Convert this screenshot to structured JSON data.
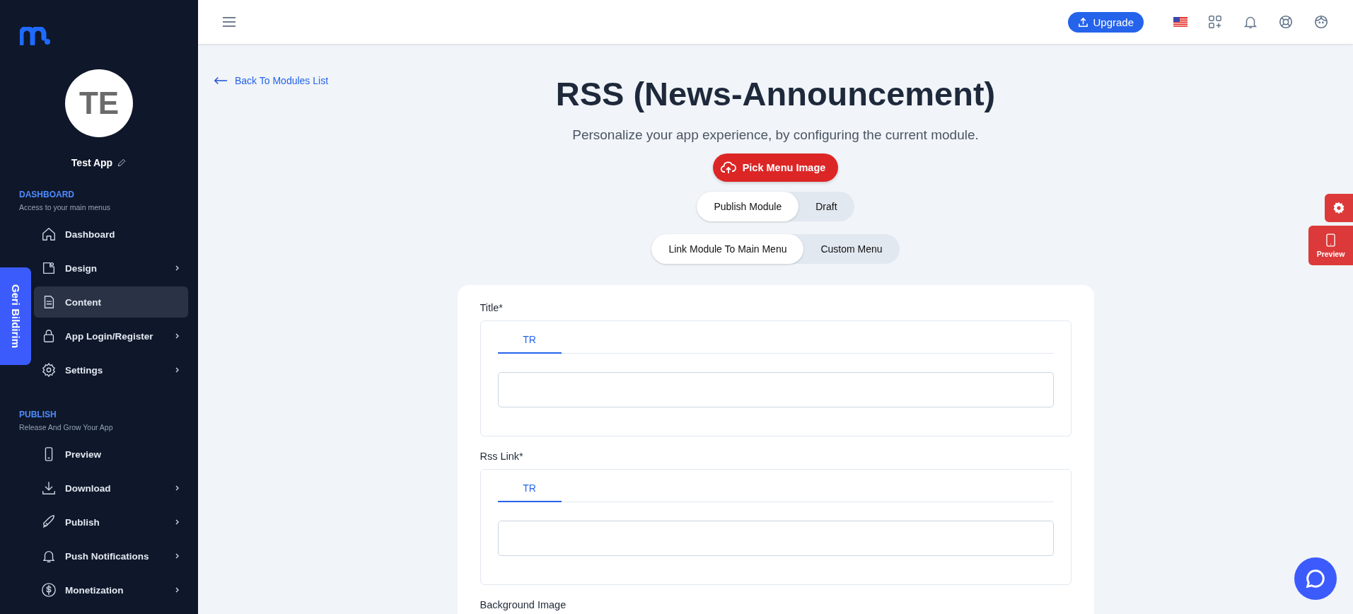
{
  "sidebar": {
    "app_avatar": "TE",
    "app_name": "Test App",
    "sections": [
      {
        "title": "DASHBOARD",
        "subtitle": "Access to your main menus",
        "items": [
          {
            "label": "Dashboard",
            "expandable": false,
            "selected": false
          },
          {
            "label": "Design",
            "expandable": true,
            "selected": false
          },
          {
            "label": "Content",
            "expandable": false,
            "selected": true
          },
          {
            "label": "App Login/Register",
            "expandable": true,
            "selected": false
          },
          {
            "label": "Settings",
            "expandable": true,
            "selected": false
          }
        ]
      },
      {
        "title": "PUBLISH",
        "subtitle": "Release And Grow Your App",
        "items": [
          {
            "label": "Preview",
            "expandable": false,
            "selected": false
          },
          {
            "label": "Download",
            "expandable": true,
            "selected": false
          },
          {
            "label": "Publish",
            "expandable": true,
            "selected": false
          },
          {
            "label": "Push Notifications",
            "expandable": true,
            "selected": false
          },
          {
            "label": "Monetization",
            "expandable": true,
            "selected": false
          }
        ]
      }
    ]
  },
  "feedback_tab": "Geri Bildirim",
  "topbar": {
    "upgrade_button": "Upgrade"
  },
  "back_link": "Back To Modules List",
  "page_title": "RSS (News-Announcement)",
  "subtitle": "Personalize your app experience, by configuring the current module.",
  "pick_image_button": "Pick Menu Image",
  "toggle_groups": [
    [
      {
        "label": "Publish Module",
        "selected": true
      },
      {
        "label": "Draft",
        "selected": false
      }
    ],
    [
      {
        "label": "Link Module To Main Menu",
        "selected": true
      },
      {
        "label": "Custom Menu",
        "selected": false
      }
    ]
  ],
  "form": {
    "fields": [
      {
        "label": "Title*",
        "tabs": [
          {
            "label": "TR",
            "selected": true
          }
        ]
      },
      {
        "label": "Rss Link*",
        "tabs": [
          {
            "label": "TR",
            "selected": true
          }
        ]
      }
    ],
    "next_label": "Background Image"
  },
  "side_buttons": {
    "preview": "Preview"
  }
}
